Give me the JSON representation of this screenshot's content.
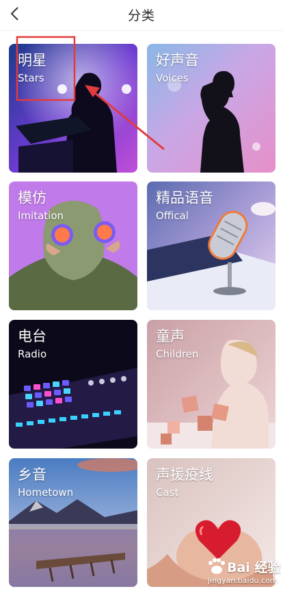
{
  "header": {
    "title": "分类",
    "back_icon": "chevron-left-icon"
  },
  "categories": [
    {
      "zh": "明星",
      "en": "Stars"
    },
    {
      "zh": "好声音",
      "en": "Voices"
    },
    {
      "zh": "模仿",
      "en": "Imitation"
    },
    {
      "zh": "精品语音",
      "en": "Offical"
    },
    {
      "zh": "电台",
      "en": "Radio"
    },
    {
      "zh": "童声",
      "en": "Children"
    },
    {
      "zh": "乡音",
      "en": "Hometown"
    },
    {
      "zh": "声援疫线",
      "en": "Cast"
    }
  ],
  "annotation": {
    "highlight_color": "#e23b3b"
  },
  "watermark": {
    "brand": "Bai 经验",
    "url": "jingyan.baidu.com"
  }
}
